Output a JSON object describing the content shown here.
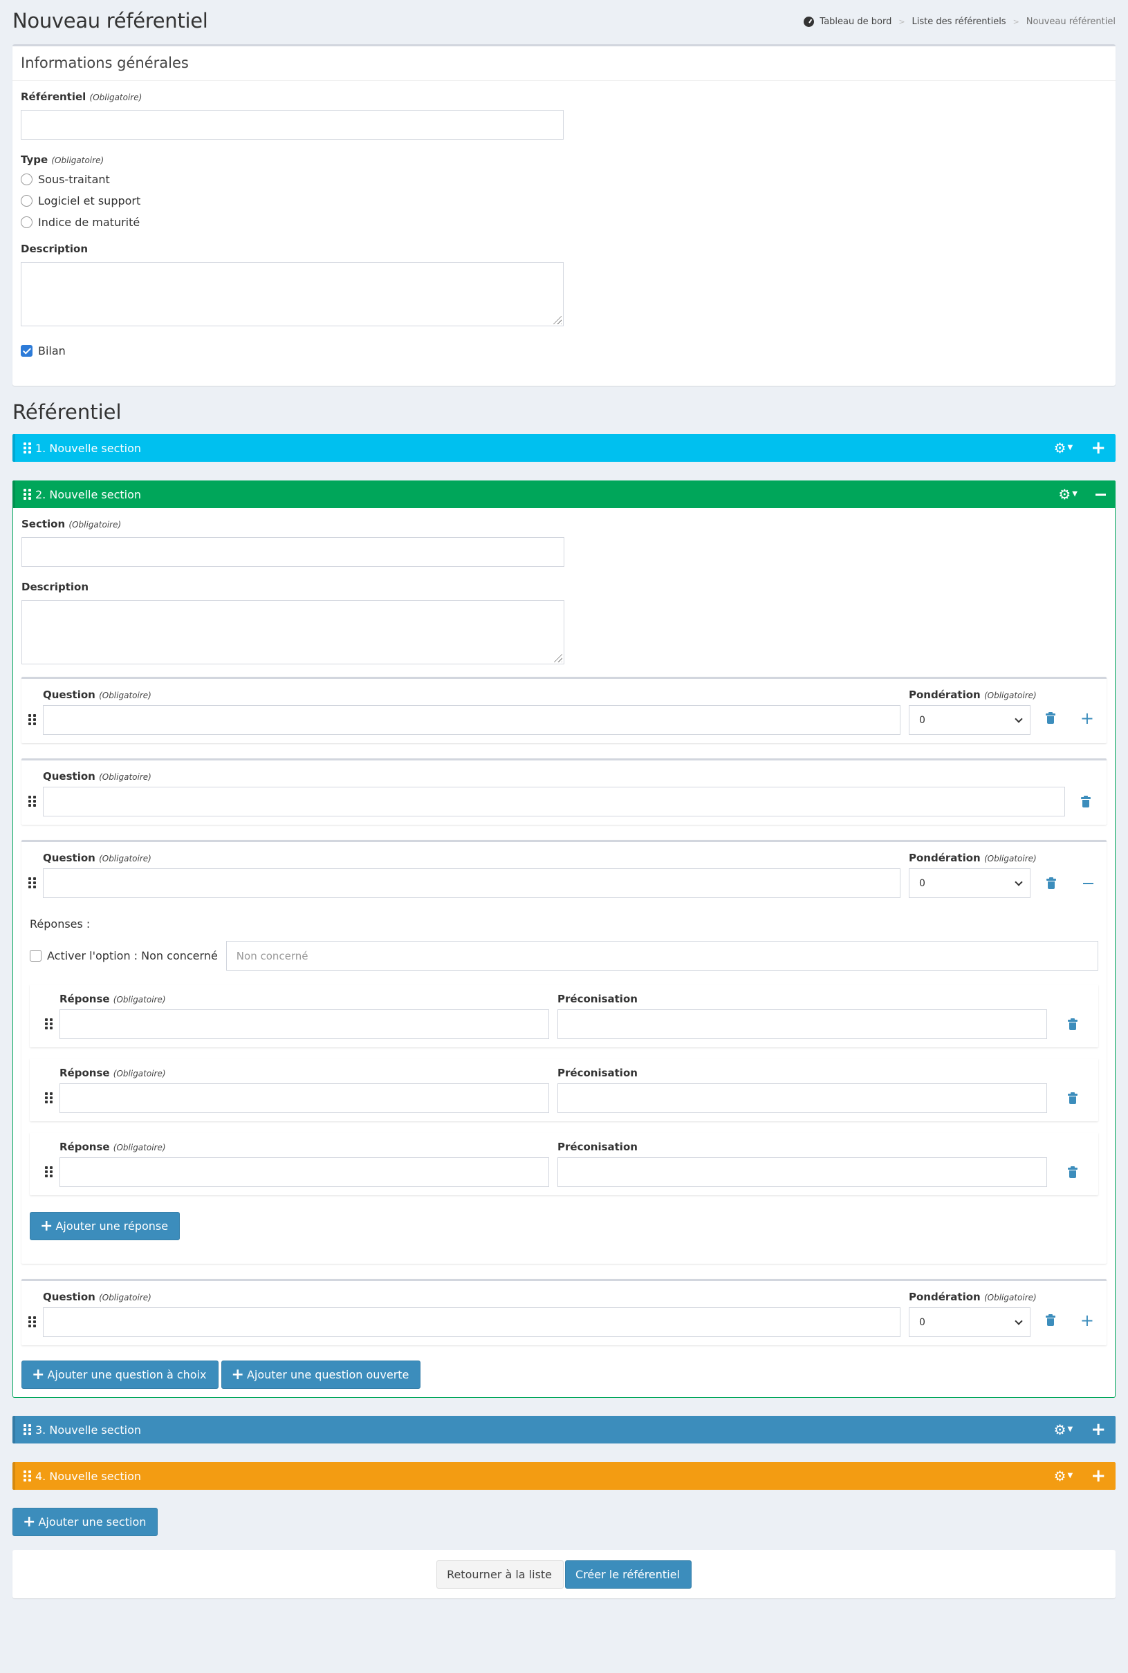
{
  "header": {
    "title": "Nouveau référentiel",
    "breadcrumb": [
      "Tableau de bord",
      "Liste des référentiels",
      "Nouveau référentiel"
    ]
  },
  "general": {
    "title": "Informations générales",
    "required_tag": "(Obligatoire)",
    "referentiel_label": "Référentiel",
    "type_label": "Type",
    "type_options": [
      "Sous-traitant",
      "Logiciel et support",
      "Indice de maturité"
    ],
    "description_label": "Description",
    "bilan_label": "Bilan",
    "bilan_checked": true
  },
  "referentiel_heading": "Référentiel",
  "colors": {
    "cyan": "#00c0ef",
    "green": "#00a65a",
    "blue": "#3c8dbc",
    "orange": "#f39c12"
  },
  "sections": [
    {
      "label": "1. Nouvelle section"
    },
    {
      "label": "2. Nouvelle section"
    },
    {
      "label": "3. Nouvelle section"
    },
    {
      "label": "4. Nouvelle section"
    }
  ],
  "open_section": {
    "section_label": "Section",
    "description_label": "Description",
    "question_label": "Question",
    "ponderation_label": "Pondération",
    "ponderation_value": "0",
    "answers_label": "Réponses :",
    "nc_label": "Activer l'option : Non concerné",
    "nc_placeholder": "Non concerné",
    "reponse_label": "Réponse",
    "preconisation_label": "Préconisation",
    "add_answer": "Ajouter une réponse",
    "add_choice_question": "Ajouter une question à choix",
    "add_open_question": "Ajouter une question ouverte"
  },
  "add_section": "Ajouter une section",
  "footer": {
    "back": "Retourner à la liste",
    "create": "Créer le référentiel"
  },
  "icons": [
    "dashboard-icon",
    "grip-icon",
    "gear-icon",
    "plus-icon",
    "minus-icon",
    "trash-icon",
    "chevron-down-icon"
  ]
}
